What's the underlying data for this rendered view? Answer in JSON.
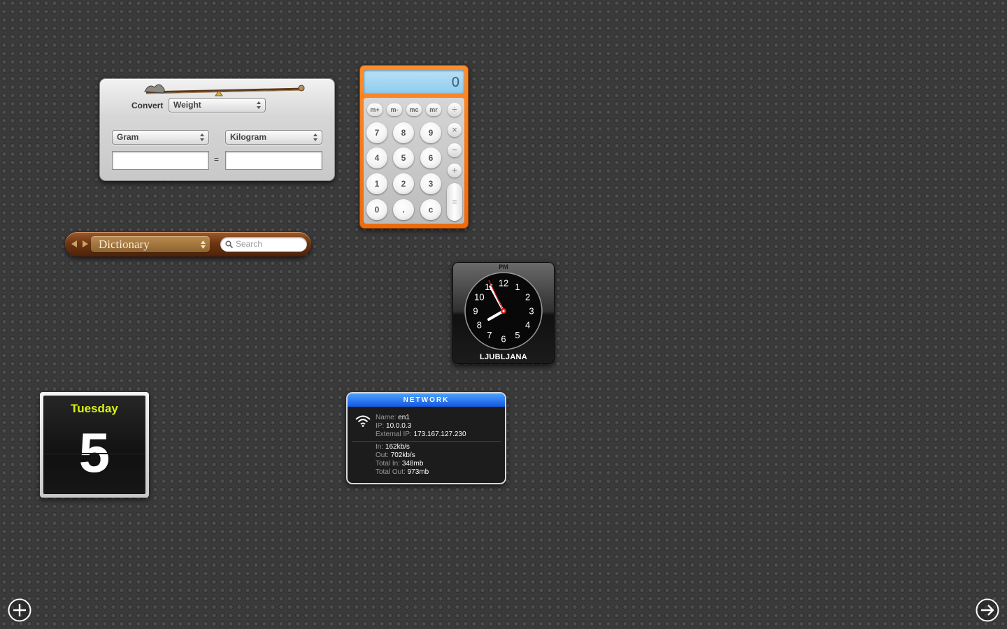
{
  "converter": {
    "convert_label": "Convert",
    "category": "Weight",
    "from_unit": "Gram",
    "to_unit": "Kilogram",
    "equals": "=",
    "from_value": "",
    "to_value": ""
  },
  "calculator": {
    "display": "0",
    "memory_keys": [
      "m+",
      "m-",
      "mc",
      "mr"
    ],
    "digits": [
      "7",
      "8",
      "9",
      "4",
      "5",
      "6",
      "1",
      "2",
      "3",
      "0",
      ".",
      "c"
    ],
    "operators": [
      "÷",
      "×",
      "−",
      "+"
    ],
    "equals": "="
  },
  "dictionary": {
    "source": "Dictionary",
    "search_placeholder": "Search"
  },
  "clock": {
    "period": "PM",
    "city": "LJUBLJANA",
    "numerals": [
      "12",
      "1",
      "2",
      "3",
      "4",
      "5",
      "6",
      "7",
      "8",
      "9",
      "10",
      "11"
    ]
  },
  "calendar": {
    "day_name": "Tuesday",
    "day_number": "5"
  },
  "network": {
    "title": "NETWORK",
    "name_label": "Name:",
    "name": "en1",
    "ip_label": "IP:",
    "ip": "10.0.0.3",
    "external_ip_label": "External IP:",
    "external_ip": "173.167.127.230",
    "in_label": "In:",
    "in": "162kb/s",
    "out_label": "Out:",
    "out": "702kb/s",
    "total_in_label": "Total In:",
    "total_in": "348mb",
    "total_out_label": "Total Out:",
    "total_out": "973mb"
  },
  "icons": {
    "add_widget": "plus-circle-icon",
    "manage_widgets": "arrow-right-circle-icon"
  },
  "colors": {
    "calculator_orange": "#f07a18",
    "calendar_day_green": "#d7f215",
    "network_header_blue": "#2a74f0",
    "dictionary_brown": "#6e3613"
  }
}
